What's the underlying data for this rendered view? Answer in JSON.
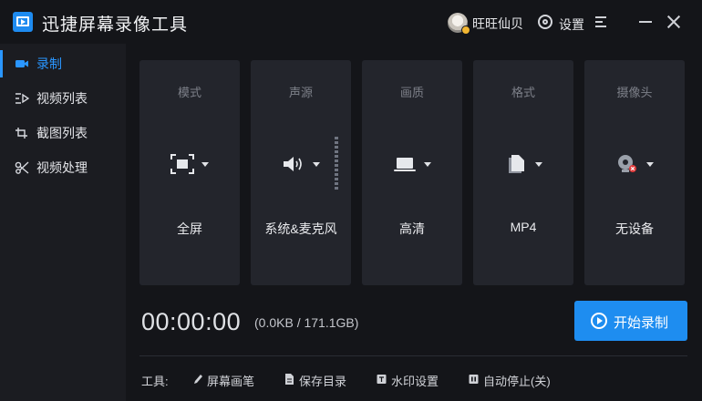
{
  "app": {
    "title": "迅捷屏幕录像工具",
    "username": "旺旺仙贝",
    "settings_label": "设置",
    "accent_color": "#1e8df0"
  },
  "sidebar": {
    "items": [
      {
        "label": "录制",
        "icon": "camera-icon",
        "active": true
      },
      {
        "label": "视频列表",
        "icon": "video-list-icon",
        "active": false
      },
      {
        "label": "截图列表",
        "icon": "screenshot-list-icon",
        "active": false
      },
      {
        "label": "视频处理",
        "icon": "video-tools-icon",
        "active": false
      }
    ]
  },
  "cards": [
    {
      "title": "模式",
      "value": "全屏",
      "icon": "fullscreen-icon"
    },
    {
      "title": "声源",
      "value": "系统&麦克风",
      "icon": "speaker-icon"
    },
    {
      "title": "画质",
      "value": "高清",
      "icon": "laptop-icon"
    },
    {
      "title": "格式",
      "value": "MP4",
      "icon": "file-icon"
    },
    {
      "title": "摄像头",
      "value": "无设备",
      "icon": "webcam-icon"
    }
  ],
  "recording": {
    "timer": "00:00:00",
    "size_info": "(0.0KB / 171.1GB)",
    "start_label": "开始录制"
  },
  "toolbar": {
    "label": "工具:",
    "items": [
      {
        "label": "屏幕画笔",
        "icon": "pen-icon"
      },
      {
        "label": "保存目录",
        "icon": "document-icon"
      },
      {
        "label": "水印设置",
        "icon": "watermark-icon"
      },
      {
        "label": "自动停止(关)",
        "icon": "pause-icon"
      }
    ]
  }
}
